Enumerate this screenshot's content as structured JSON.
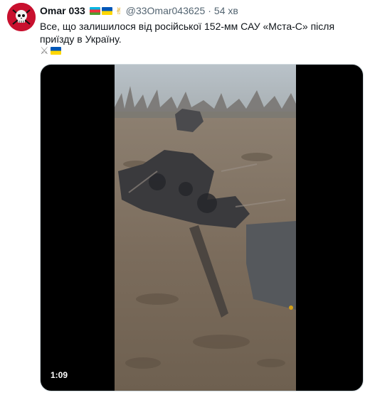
{
  "tweet": {
    "author_name": "Omar 033",
    "handle": "@33Omar043625",
    "separator": "·",
    "time": "54 хв",
    "text": "Все, що залишилося від російської 152-мм САУ «Мста-С» після приїзду в Україну.",
    "header_icons": [
      "azerbaijan-flag",
      "ukraine-flag",
      "victory-hand"
    ],
    "emoji_row": [
      "crossed-swords",
      "ukraine-flag"
    ],
    "video": {
      "duration": "1:09"
    }
  },
  "colors": {
    "text_primary": "#0f1419",
    "text_secondary": "#536471",
    "avatar_bg": "#c8102e",
    "media_bg": "#000000"
  }
}
